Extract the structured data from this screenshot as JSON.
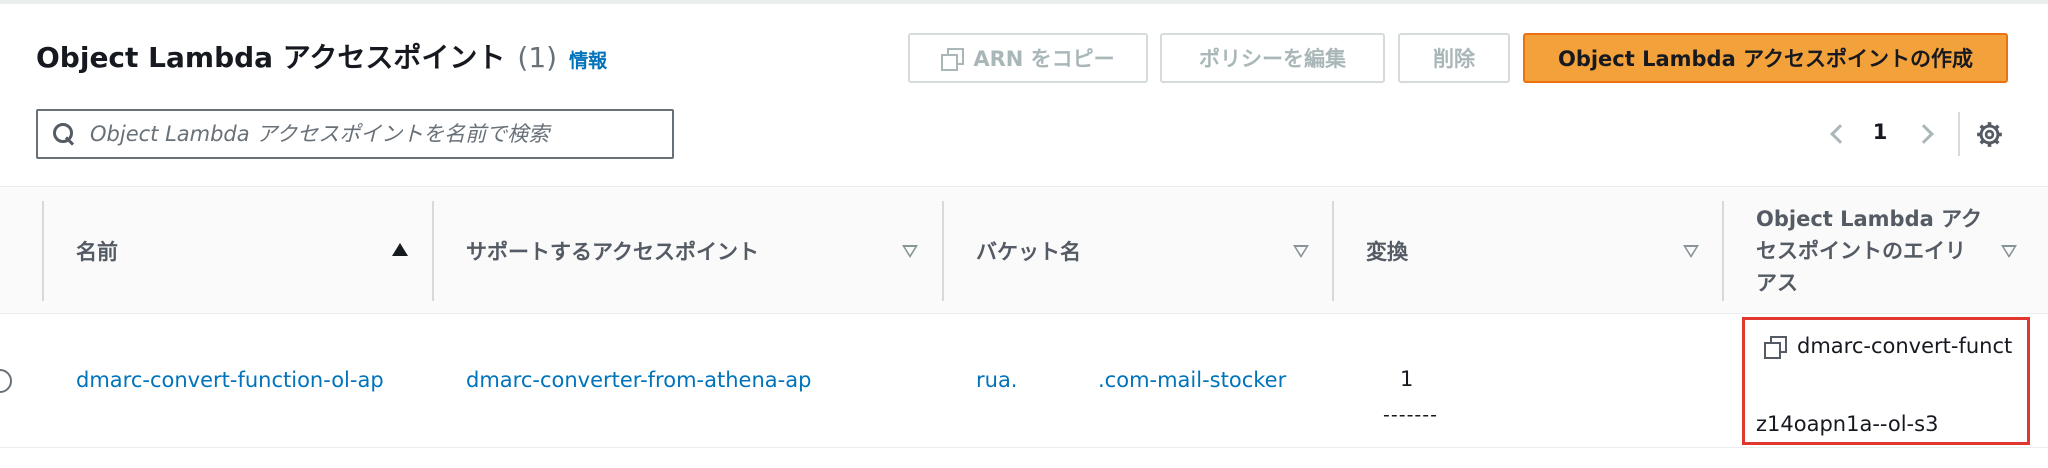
{
  "header": {
    "title": "Object Lambda アクセスポイント",
    "count": "(1)",
    "info_link": "情報"
  },
  "toolbar": {
    "copy_arn_label": "ARN をコピー",
    "edit_policy_label": "ポリシーを編集",
    "delete_label": "削除",
    "create_label": "Object Lambda アクセスポイントの作成"
  },
  "search": {
    "placeholder": "Object Lambda アクセスポイントを名前で検索",
    "value": ""
  },
  "pagination": {
    "current_page": "1"
  },
  "table": {
    "columns": [
      {
        "label": "名前",
        "sort": "ascending"
      },
      {
        "label": "サポートするアクセスポイント",
        "sort": "none"
      },
      {
        "label": "バケット名",
        "sort": "none"
      },
      {
        "label": "変換",
        "sort": "none"
      },
      {
        "label_lines": [
          "Object Lambda アク",
          "セスポイントのエイリ",
          "アス"
        ],
        "sort": "none"
      }
    ],
    "rows": [
      {
        "name": "dmarc-convert-function-ol-ap",
        "supporting_access_point": "dmarc-converter-from-athena-ap",
        "bucket_prefix": "rua.",
        "bucket_suffix": ".com-mail-stocker",
        "transformations": "1",
        "transformations_detail": "-------",
        "alias_line1": "dmarc-convert-funct",
        "alias_line2": "z14oapn1a--ol-s3"
      }
    ]
  },
  "colors": {
    "primary_button": "#f3a23b",
    "link": "#0073bb",
    "highlight_border": "#e0382e"
  },
  "icons": [
    "copy-icon",
    "search-icon",
    "chevron-left-icon",
    "chevron-right-icon",
    "gear-icon",
    "sort-ascending-icon",
    "sort-descending-icon"
  ]
}
